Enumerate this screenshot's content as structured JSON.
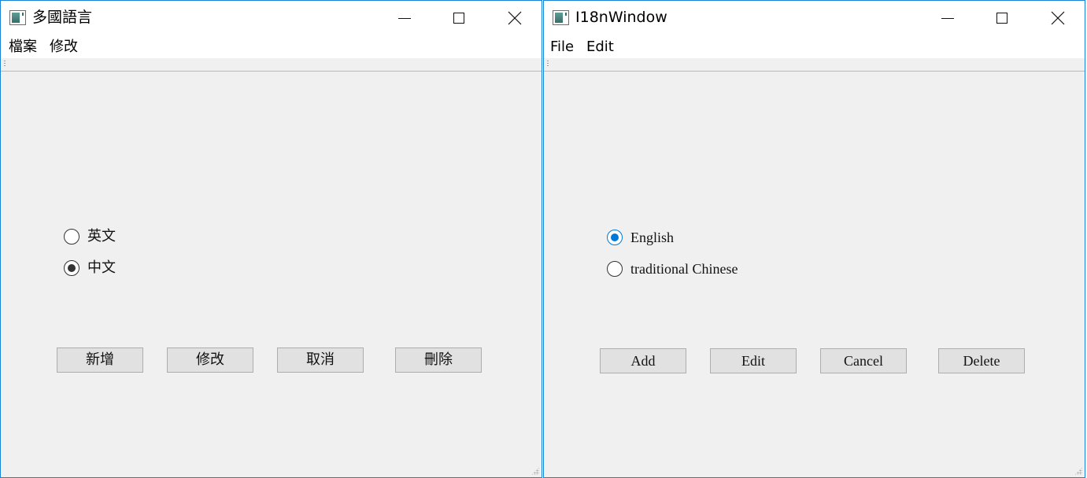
{
  "windows": [
    {
      "title": "多國語言",
      "menu": [
        "檔案",
        "修改"
      ],
      "radios": [
        {
          "label": "英文",
          "checked": false
        },
        {
          "label": "中文",
          "checked": true
        }
      ],
      "buttons": [
        "新增",
        "修改",
        "取消",
        "刪除"
      ]
    },
    {
      "title": "I18nWindow",
      "menu": [
        "File",
        "Edit"
      ],
      "radios": [
        {
          "label": "English",
          "checked": true
        },
        {
          "label": "traditional Chinese",
          "checked": false
        }
      ],
      "buttons": [
        "Add",
        "Edit",
        "Cancel",
        "Delete"
      ]
    }
  ],
  "icons": {
    "app": "app-window-icon",
    "minimize": "minimize-icon",
    "maximize": "maximize-icon",
    "close": "close-icon",
    "resize_grip": "resize-grip-icon"
  },
  "colors": {
    "window_border": "#1883d7",
    "client_background": "#f0f0f0",
    "radio_accent": "#0078d7",
    "button_face": "#e1e1e1"
  }
}
